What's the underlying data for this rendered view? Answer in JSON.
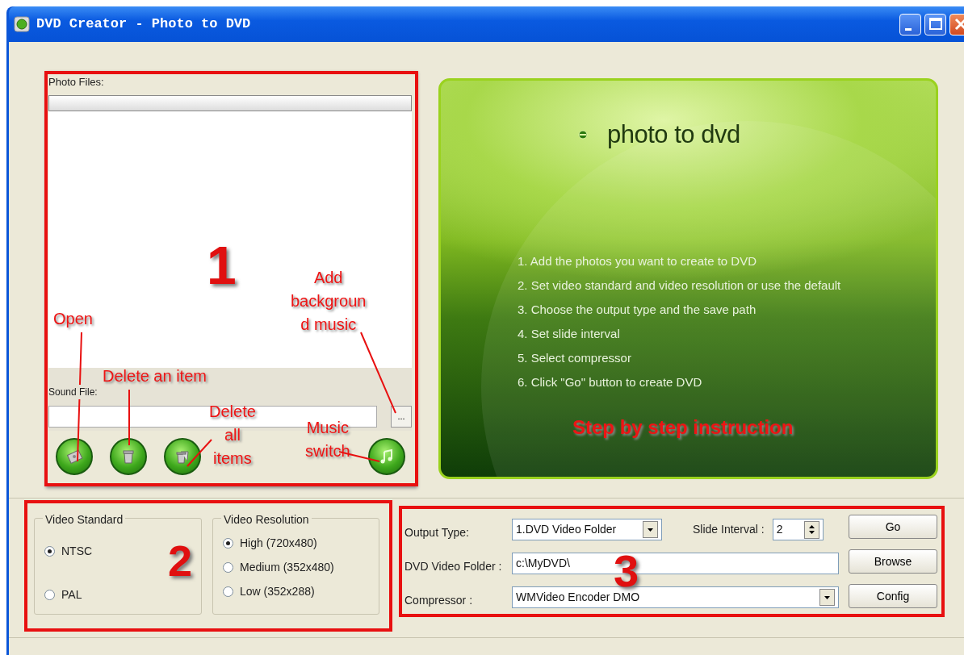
{
  "window": {
    "title": "DVD Creator - Photo to DVD"
  },
  "photo_files": {
    "label": "Photo Files:"
  },
  "sound_file": {
    "label": "Sound File:",
    "browse_button": "..."
  },
  "tool_buttons": [
    {
      "kind": "open"
    },
    {
      "kind": "delete"
    },
    {
      "kind": "delete_all"
    },
    {
      "kind": "music"
    }
  ],
  "banner": {
    "title": "photo to dvd",
    "steps": [
      "1. Add the photos you want to create to DVD",
      "2. Set video standard and video resolution or use the default",
      "3. Choose the output type and the save path",
      "4. Set slide interval",
      "5. Select compressor",
      "6. Click \"Go\" button to create DVD"
    ]
  },
  "video_standard": {
    "legend": "Video Standard",
    "options": [
      {
        "label": "NTSC",
        "selected": true
      },
      {
        "label": "PAL",
        "selected": false
      }
    ]
  },
  "video_resolution": {
    "legend": "Video Resolution",
    "options": [
      {
        "label": "High (720x480)",
        "selected": true
      },
      {
        "label": "Medium (352x480)",
        "selected": false
      },
      {
        "label": "Low (352x288)",
        "selected": false
      }
    ]
  },
  "output": {
    "output_type_label": "Output Type:",
    "output_type": "1.DVD Video Folder",
    "slide_interval_label": "Slide Interval :",
    "slide_interval": "2",
    "folder_label": "DVD Video Folder :",
    "folder": "c:\\MyDVD\\",
    "compressor_label": "Compressor :",
    "compressor": "WMVideo Encoder DMO"
  },
  "buttons": [
    "Go",
    "Browse",
    "Config"
  ],
  "annotations": {
    "region_numbers": [
      "1",
      "2",
      "3"
    ],
    "callouts": [
      {
        "lines": [
          "Open"
        ]
      },
      {
        "lines": [
          "Delete an item"
        ]
      },
      {
        "lines": [
          "Delete",
          "all",
          "items"
        ]
      },
      {
        "lines": [
          "Add",
          "backgroun",
          "d music"
        ]
      },
      {
        "lines": [
          "Music",
          "switch"
        ]
      },
      {
        "lines": [
          "Step by step instruction"
        ]
      }
    ]
  }
}
